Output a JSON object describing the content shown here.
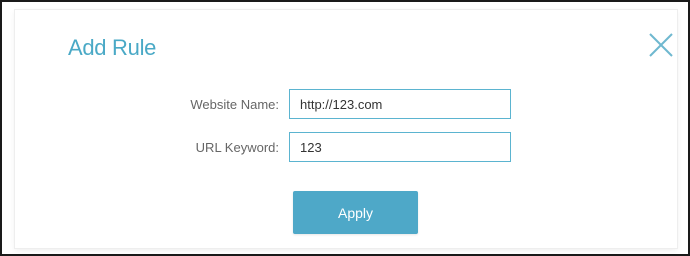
{
  "dialog": {
    "title": "Add Rule",
    "close_icon": "close-icon"
  },
  "form": {
    "website_name": {
      "label": "Website Name:",
      "value": "http://123.com"
    },
    "url_keyword": {
      "label": "URL Keyword:",
      "value": "123"
    }
  },
  "actions": {
    "apply_label": "Apply"
  },
  "colors": {
    "accent": "#4aa9c6",
    "button": "#4ea8c8",
    "field_border": "#5bb4d0",
    "label_text": "#666666"
  }
}
